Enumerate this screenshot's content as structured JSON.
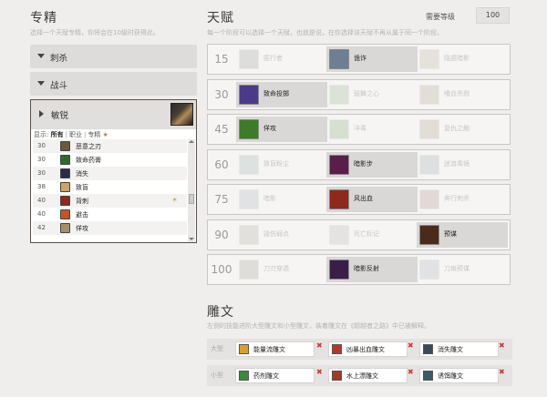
{
  "spec": {
    "title": "专精",
    "desc": "选择一个天赋专精，你将会在10级时获得此。",
    "rows": [
      "刺杀",
      "战斗"
    ],
    "selected": "敏锐",
    "filter": {
      "label": "显示:",
      "all": "所有",
      "class": "职业",
      "spec": "专精",
      "star": "★"
    },
    "abilities": [
      {
        "lv": "30",
        "name": "恶意之刃",
        "color": "#6b5a3c"
      },
      {
        "lv": "30",
        "name": "致命药膏",
        "color": "#2f6b2a"
      },
      {
        "lv": "30",
        "name": "消失",
        "color": "#2b2b4a"
      },
      {
        "lv": "38",
        "name": "致盲",
        "color": "#caa46b"
      },
      {
        "lv": "40",
        "name": "背刺",
        "color": "#8a2b1c",
        "star": true
      },
      {
        "lv": "40",
        "name": "避击",
        "color": "#c0562a"
      },
      {
        "lv": "42",
        "name": "佯攻",
        "color": "#a78e6a"
      }
    ]
  },
  "talents": {
    "title": "天赋",
    "desc": "每一个阶段可以选择一个天赋，也就是说，在你选择该天赋不再从属于同一个阶段。",
    "level_label": "需要等级",
    "level_value": "100",
    "tiers": [
      {
        "lv": "15",
        "slots": [
          {
            "name": "匿行者",
            "sel": false,
            "color": "#8a8a8a"
          },
          {
            "name": "诡诈",
            "sel": true,
            "color": "#6e7f93"
          },
          {
            "name": "隐遁暗影",
            "sel": false,
            "color": "#b0a080"
          }
        ]
      },
      {
        "lv": "30",
        "slots": [
          {
            "name": "致命投掷",
            "sel": true,
            "color": "#4b3a8a"
          },
          {
            "name": "鼓舞之心",
            "sel": false,
            "color": "#7ea070"
          },
          {
            "name": "嗜血杀戮",
            "sel": false,
            "color": "#a09070"
          }
        ]
      },
      {
        "lv": "45",
        "slots": [
          {
            "name": "佯攻",
            "sel": true,
            "color": "#3d7a2a"
          },
          {
            "name": "淬毒",
            "sel": false,
            "color": "#6a9a50"
          },
          {
            "name": "复仇之触",
            "sel": false,
            "color": "#a08a6a"
          }
        ]
      },
      {
        "lv": "60",
        "slots": [
          {
            "name": "致盲粉尘",
            "sel": false,
            "color": "#8aa0a0"
          },
          {
            "name": "暗影步",
            "sel": true,
            "color": "#5a1e4a"
          },
          {
            "name": "迷渡毒镜",
            "sel": false,
            "color": "#8a9aa0"
          }
        ]
      },
      {
        "lv": "75",
        "slots": [
          {
            "name": "暗影",
            "sel": false,
            "color": "#9aa0a8"
          },
          {
            "name": "风出血",
            "sel": true,
            "color": "#8a2b1c"
          },
          {
            "name": "奔行刺杀",
            "sel": false,
            "color": "#a07a6a"
          }
        ]
      },
      {
        "lv": "90",
        "slots": [
          {
            "name": "毁伤弱点",
            "sel": false,
            "color": "#9a9a8a"
          },
          {
            "name": "死亡标记",
            "sel": false,
            "color": "#a8a8a0"
          },
          {
            "name": "预谋",
            "sel": true,
            "color": "#4a2a1a"
          }
        ]
      },
      {
        "lv": "100",
        "slots": [
          {
            "name": "刀刃穿透",
            "sel": false,
            "color": "#8a9080"
          },
          {
            "name": "暗影反射",
            "sel": true,
            "color": "#3a1e4a"
          },
          {
            "name": "刀扇预谋",
            "sel": false,
            "color": "#9aa0a8"
          }
        ]
      }
    ]
  },
  "glyphs": {
    "title": "雕文",
    "desc": "左侧的技能进阶大型雕文和小型雕文，装着雕文在《超越者之路》中已被解释。",
    "rows": [
      {
        "label": "大型",
        "cells": [
          {
            "name": "能量流雕文",
            "color": "#d8a030"
          },
          {
            "name": "凶暴出血雕文",
            "color": "#b03a2a"
          },
          {
            "name": "消失雕文",
            "color": "#3a4a5a"
          }
        ]
      },
      {
        "label": "小型",
        "cells": [
          {
            "name": "药剂雕文",
            "color": "#3a8a3a"
          },
          {
            "name": "水上漂雕文",
            "color": "#a03a2a"
          },
          {
            "name": "诱饵雕文",
            "color": "#3a5a6a"
          }
        ]
      }
    ],
    "remove": "✖"
  }
}
